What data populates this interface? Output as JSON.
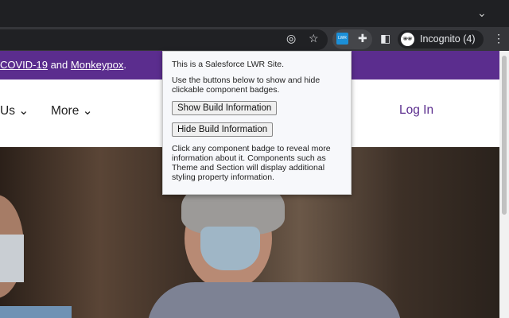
{
  "browser": {
    "profile_label": "Incognito (4)",
    "extension_badge": "LWR"
  },
  "banner": {
    "link1": "COVID-19",
    "mid": " and ",
    "link2": "Monkeypox",
    "end": "."
  },
  "nav": {
    "item_partial": "Us",
    "more": "More",
    "login": "Log In"
  },
  "popup": {
    "intro": "This is a Salesforce LWR Site.",
    "instructions": "Use the buttons below to show and hide clickable component badges.",
    "show_button": "Show Build Information",
    "hide_button": "Hide Build Information",
    "footer": "Click any component badge to reveal more information about it. Components such as Theme and Section will display additional styling property information."
  }
}
